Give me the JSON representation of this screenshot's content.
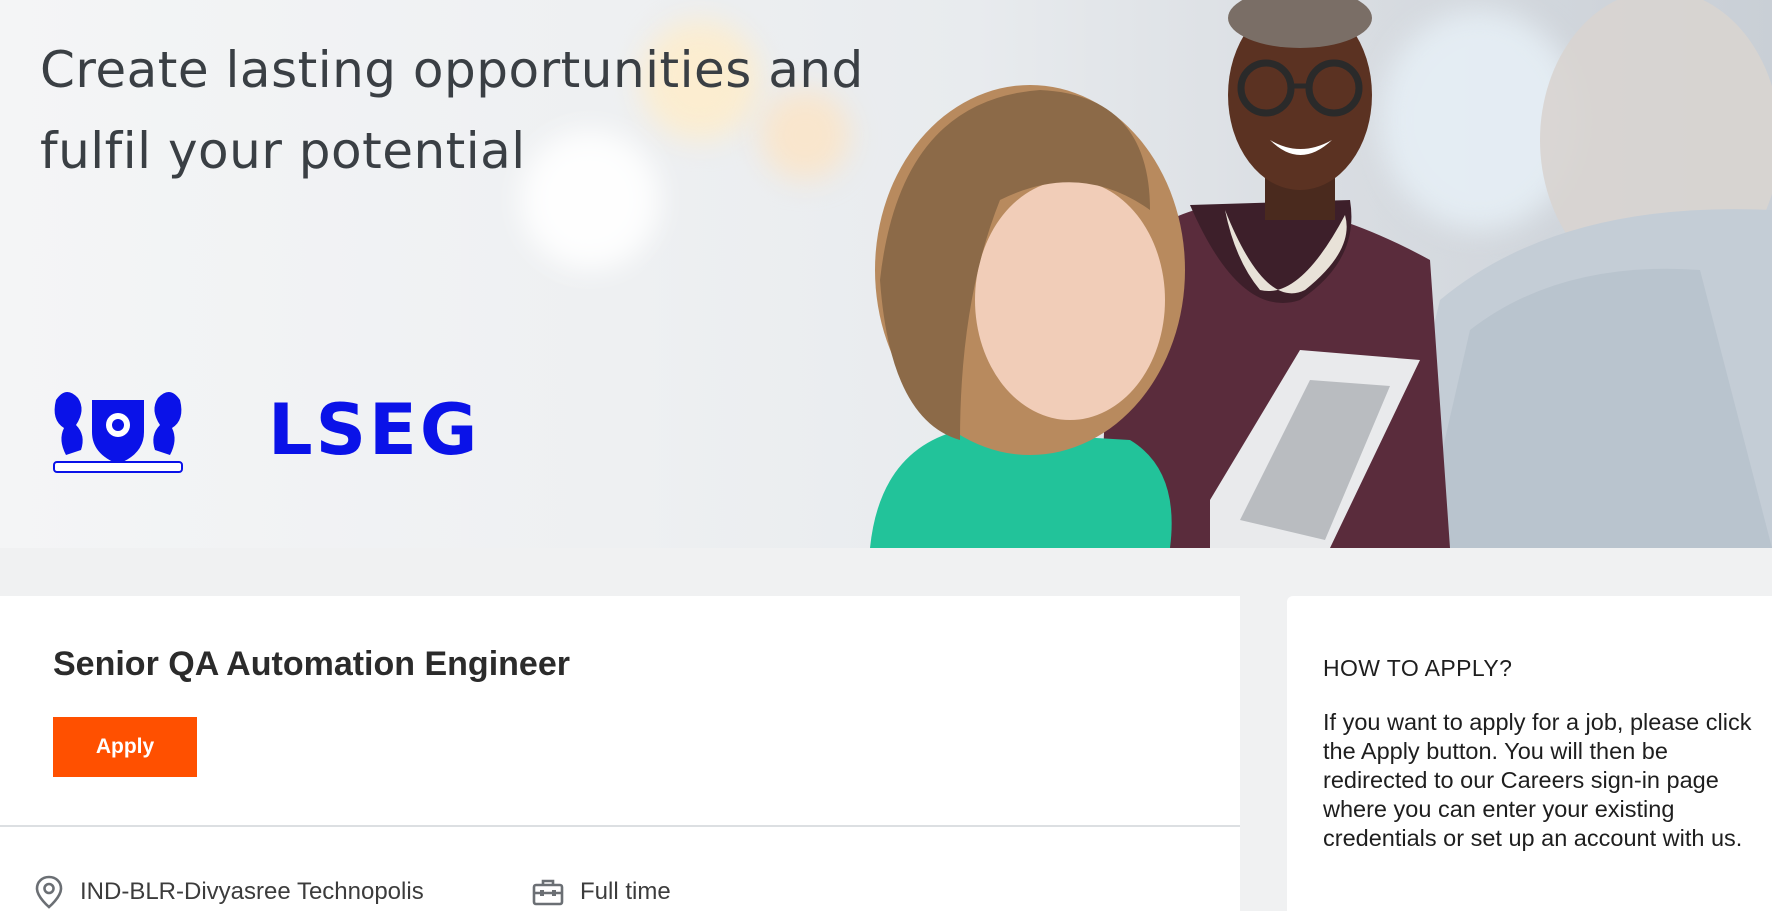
{
  "hero": {
    "headline": "Create lasting opportunities and fulfil your potential",
    "logo_text": "LSEG"
  },
  "job": {
    "title": "Senior QA Automation Engineer",
    "apply_label": "Apply",
    "location": "IND-BLR-Divyasree Technopolis",
    "employment_type": "Full time"
  },
  "how_to_apply": {
    "title": "HOW TO APPLY?",
    "body": "If you want to apply for a job, please click the Apply button. You will then be redirected to our Careers sign-in page where you can enter your existing credentials or set up an account with us."
  },
  "colors": {
    "accent": "#ff5000",
    "logo_blue": "#0a12e8",
    "page_bg": "#f0f1f2"
  },
  "icons": [
    "location-pin-icon",
    "briefcase-icon"
  ]
}
